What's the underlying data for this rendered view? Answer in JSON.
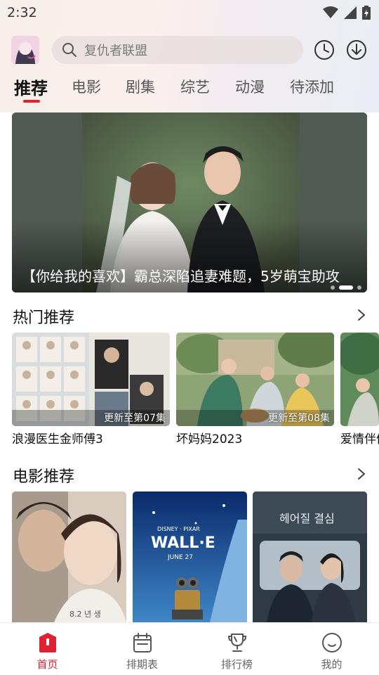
{
  "status_bar": {
    "time": "2:32"
  },
  "search": {
    "placeholder": "复仇者联盟"
  },
  "tabs": [
    {
      "label": "推荐",
      "active": true
    },
    {
      "label": "电影"
    },
    {
      "label": "剧集"
    },
    {
      "label": "综艺"
    },
    {
      "label": "动漫"
    },
    {
      "label": "待添加"
    }
  ],
  "banner": {
    "caption": "【你给我的喜欢】霸总深陷追妻难题，5岁萌宝助攻",
    "dot_count": 3,
    "active_dot": 1
  },
  "hot_section": {
    "title": "热门推荐",
    "items": [
      {
        "title": "浪漫医生金师傅3",
        "badge": "更新至第07集"
      },
      {
        "title": "坏妈妈2023",
        "badge": "更新至第08集"
      },
      {
        "title": "爱情伴侣",
        "badge": ""
      }
    ]
  },
  "movie_section": {
    "title": "电影推荐",
    "items": [
      {
        "poster_text": "8.2 년 생"
      },
      {
        "poster_text": "WALL·E",
        "poster_sub": "JUNE 27",
        "poster_brand": "DISNEY · PIXAR"
      },
      {
        "poster_text": "헤어질 결심"
      }
    ]
  },
  "bottom_nav": [
    {
      "label": "首页",
      "icon": "home-icon",
      "active": true
    },
    {
      "label": "排期表",
      "icon": "calendar-icon"
    },
    {
      "label": "排行榜",
      "icon": "trophy-icon"
    },
    {
      "label": "我的",
      "icon": "profile-icon"
    }
  ],
  "colors": {
    "accent": "#e02233",
    "banner_bg": "#4e5950"
  }
}
